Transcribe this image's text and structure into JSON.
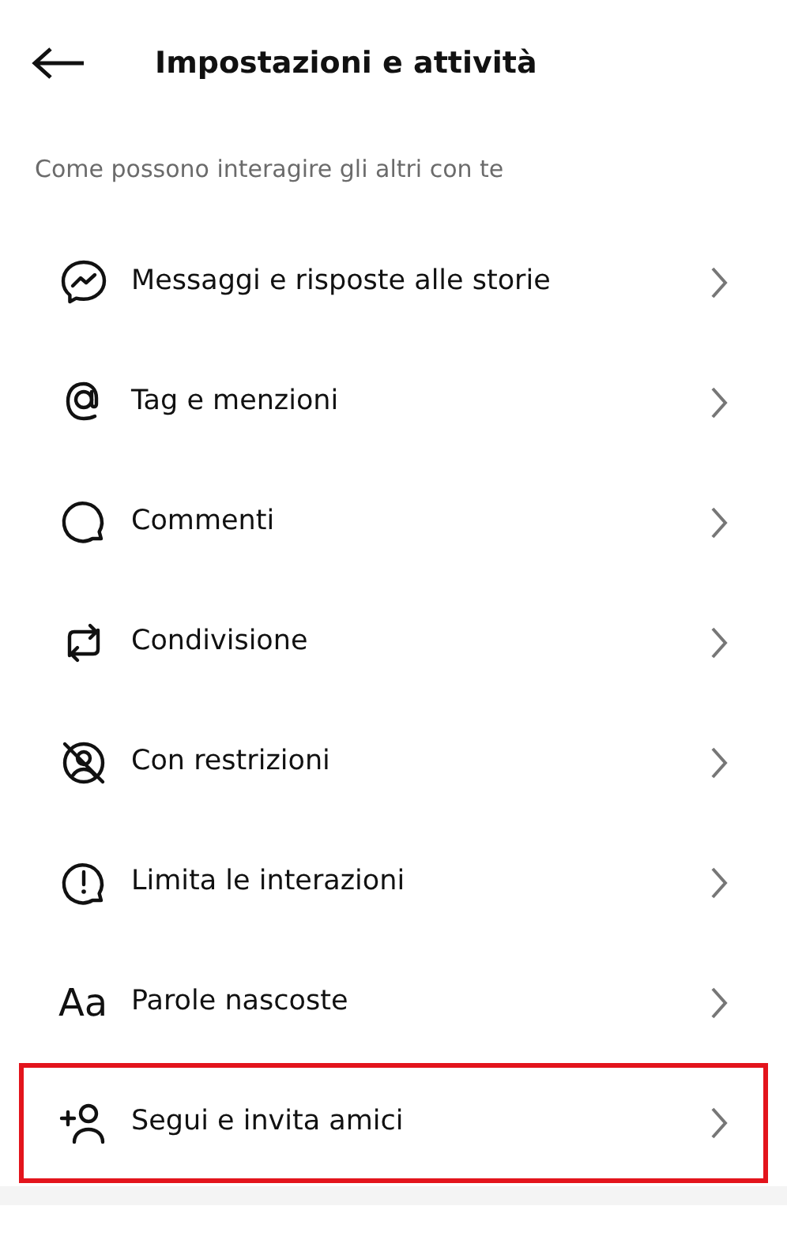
{
  "header": {
    "title": "Impostazioni e attività"
  },
  "section": {
    "title": "Come possono interagire gli altri con te"
  },
  "items": [
    {
      "label": "Messaggi e risposte alle storie",
      "kind": "messenger",
      "highlighted": false
    },
    {
      "label": "Tag e menzioni",
      "kind": "at",
      "highlighted": false
    },
    {
      "label": "Commenti",
      "kind": "comment",
      "highlighted": false
    },
    {
      "label": "Condivisione",
      "kind": "share",
      "highlighted": false
    },
    {
      "label": "Con restrizioni",
      "kind": "restrict",
      "highlighted": false
    },
    {
      "label": "Limita le interazioni",
      "kind": "limit",
      "highlighted": false
    },
    {
      "label": "Parole nascoste",
      "kind": "text",
      "icon_text": "Aa",
      "highlighted": false
    },
    {
      "label": "Segui e invita amici",
      "kind": "add-person",
      "highlighted": true
    }
  ]
}
